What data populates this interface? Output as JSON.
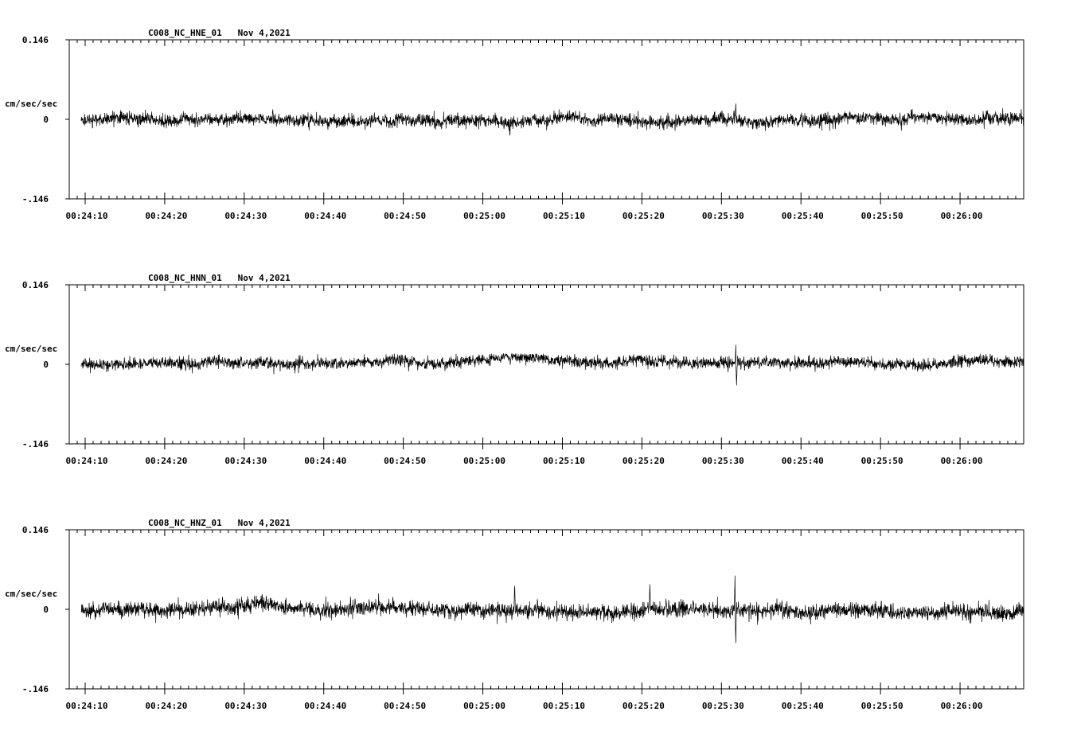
{
  "chart_data": [
    {
      "type": "line",
      "title": "C008_NC_HNE_01   Nov 4,2021",
      "ylabel": "cm/sec/sec",
      "ytick_labels": [
        "0.146",
        "0",
        "-.146"
      ],
      "ylim": [
        -0.146,
        0.146
      ],
      "xlim": [
        "00:24:08",
        "00:26:08"
      ],
      "xtick_labels": [
        "00:24:10",
        "00:24:20",
        "00:24:30",
        "00:24:40",
        "00:24:50",
        "00:25:00",
        "00:25:10",
        "00:25:20",
        "00:25:30",
        "00:25:40",
        "00:25:50",
        "00:26:00"
      ],
      "trace_start": "00:24:09.5",
      "trace_end": "00:26:08",
      "noise_amplitude": 0.013,
      "peak_amplitude": 0.036,
      "events": [
        {
          "time": "00:25:31.8",
          "amplitude": 0.03
        },
        {
          "time": "00:25:03.4",
          "amplitude": -0.035
        }
      ],
      "line_color": "#000000"
    },
    {
      "type": "line",
      "title": "C008_NC_HNN_01   Nov 4,2021",
      "ylabel": "cm/sec/sec",
      "ytick_labels": [
        "0.146",
        "0",
        "-.146"
      ],
      "ylim": [
        -0.146,
        0.146
      ],
      "xlim": [
        "00:24:08",
        "00:26:08"
      ],
      "xtick_labels": [
        "00:24:10",
        "00:24:20",
        "00:24:30",
        "00:24:40",
        "00:24:50",
        "00:25:00",
        "00:25:10",
        "00:25:20",
        "00:25:30",
        "00:25:40",
        "00:25:50",
        "00:26:00"
      ],
      "trace_start": "00:24:09.5",
      "trace_end": "00:26:08",
      "noise_amplitude": 0.012,
      "peak_amplitude": 0.033,
      "events": [
        {
          "time": "00:25:31.8",
          "amplitude": 0.037
        },
        {
          "time": "00:25:31.9",
          "amplitude": -0.04
        }
      ],
      "line_color": "#000000"
    },
    {
      "type": "line",
      "title": "C008_NC_HNZ_01   Nov 4,2021",
      "ylabel": "cm/sec/sec",
      "ytick_labels": [
        "0.146",
        "0",
        "-.146"
      ],
      "ylim": [
        -0.146,
        0.146
      ],
      "xlim": [
        "00:24:08",
        "00:26:08"
      ],
      "xtick_labels": [
        "00:24:10",
        "00:24:20",
        "00:24:30",
        "00:24:40",
        "00:24:50",
        "00:25:00",
        "00:25:10",
        "00:25:20",
        "00:25:30",
        "00:25:40",
        "00:25:50",
        "00:26:00"
      ],
      "trace_start": "00:24:09.5",
      "trace_end": "00:26:08",
      "noise_amplitude": 0.016,
      "peak_amplitude": 0.064,
      "events": [
        {
          "time": "00:25:31.7",
          "amplitude": 0.064
        },
        {
          "time": "00:25:31.8",
          "amplitude": -0.064
        },
        {
          "time": "00:25:04",
          "amplitude": 0.051
        },
        {
          "time": "00:25:21",
          "amplitude": 0.05
        }
      ],
      "line_color": "#000000"
    }
  ]
}
